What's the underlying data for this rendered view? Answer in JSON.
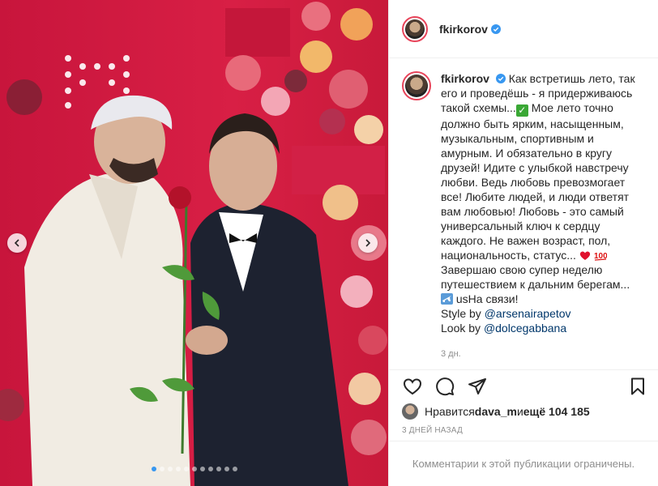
{
  "post": {
    "username": "fkirkorov",
    "caption": {
      "p1": "Как встретишь лето, так его и проведёшь - я придерживаюсь такой схемы...",
      "p2": "Мое лето точно должно быть ярким, насыщенным, музыкальным, спортивным и амурным. И обязательно в кругу друзей! Идите с улыбкой навстречу любви. Ведь любовь превозмогает все! Любите людей, и люди ответят вам любовью! Любовь - это самый универсальный ключ к сердцу каждого. Не важен возраст, пол, национальность, статус...",
      "p3": "Завершаю свою супер неделю путешествием к дальним берегам...",
      "p4": "usНа связи!",
      "style_label": "Style by ",
      "style_mention": "@arsenairapetov",
      "look_label": "Look by ",
      "look_mention": "@dolcegabbana"
    },
    "caption_time": "3 дн.",
    "likes": {
      "prefix": "Нравится ",
      "first_user": "dava_m",
      "middle": " и ",
      "others": "ещё 104 185"
    },
    "posted_ago": "3 дней назад",
    "comments_restricted": "Комментарии к этой публикации ограничены."
  },
  "carousel": {
    "slide_count": 11,
    "active_index": 0
  },
  "colors": {
    "verified": "#3897f0",
    "mention": "#00376b",
    "muted": "#8e8e8e"
  },
  "icons": {
    "like": "heart-icon",
    "comment": "comment-icon",
    "share": "paper-plane-icon",
    "save": "bookmark-icon"
  }
}
